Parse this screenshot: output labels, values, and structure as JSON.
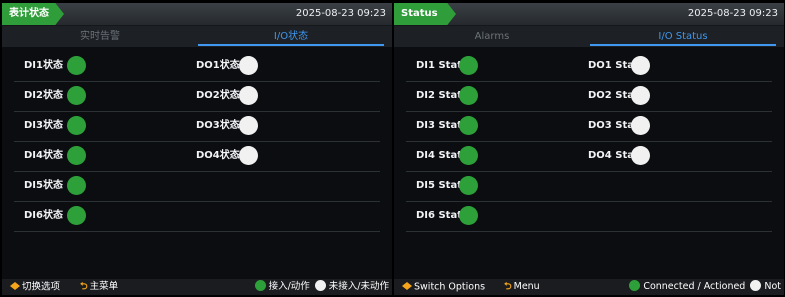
{
  "screens": [
    {
      "page_tag": "表计状态",
      "datetime": "2025-08-23  09:23",
      "tabs": [
        "实时告警",
        "I/O状态"
      ],
      "di": [
        "DI1状态",
        "DI2状态",
        "DI3状态",
        "DI4状态",
        "DI5状态",
        "DI6状态"
      ],
      "do": [
        "DO1状态",
        "DO2状态",
        "DO3状态",
        "DO4状态"
      ],
      "footer": {
        "switch_label": "切换选项",
        "menu_label": "主菜单",
        "legend_on": "接入/动作",
        "legend_off": "未接入/未动作"
      }
    },
    {
      "page_tag": "Status",
      "datetime": "2025-08-23  09:23",
      "tabs": [
        "Alarms",
        "I/O Status"
      ],
      "di": [
        "DI1 Stat",
        "DI2 Stat",
        "DI3 Stat",
        "DI4 Stat",
        "DI5 Stat",
        "DI6 Stat"
      ],
      "do": [
        "DO1 Stat",
        "DO2 Stat",
        "DO3 Stat",
        "DO4 Stat"
      ],
      "footer": {
        "switch_label": "Switch Options",
        "menu_label": "Menu",
        "legend_on": "Connected / Actioned",
        "legend_off": "Not"
      }
    }
  ],
  "status": {
    "di": [
      "on",
      "on",
      "on",
      "on",
      "on",
      "on"
    ],
    "do": [
      "off",
      "off",
      "off",
      "off"
    ]
  },
  "colors": {
    "active": "#2ea03a",
    "inactive": "#f1f1f1",
    "accent_tab": "#3f97ef",
    "page_tag": "#2f9e3a",
    "key_icon": "#f4a51c"
  },
  "icons": {
    "switch": "left-right-arrows-icon",
    "menu": "return-arrow-icon"
  }
}
